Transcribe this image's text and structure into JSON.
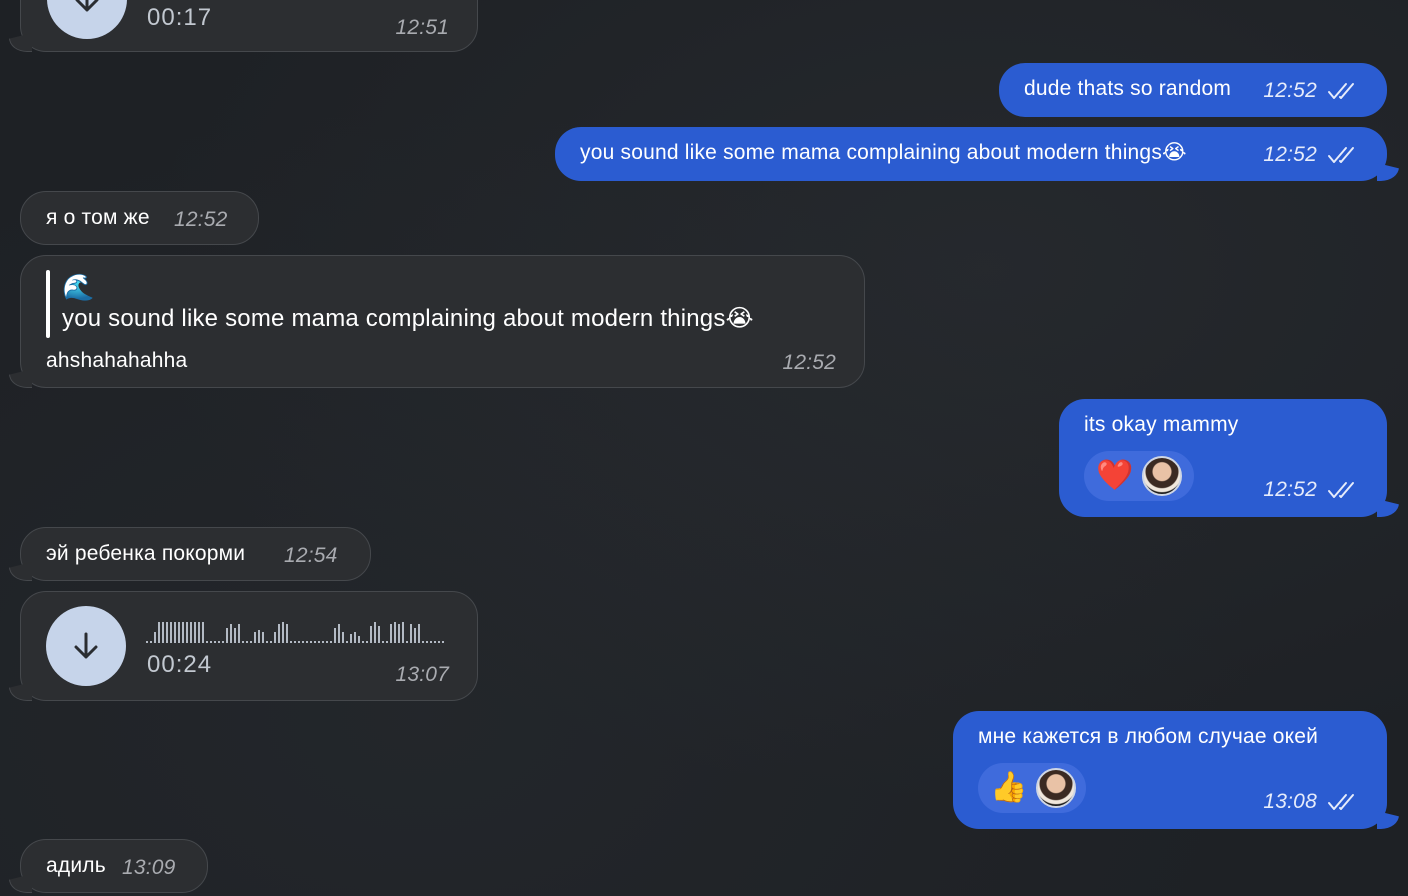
{
  "messages": {
    "voice_top": {
      "duration": "00:17",
      "time": "12:51"
    },
    "out_random": {
      "text": "dude thats so random",
      "time": "12:52"
    },
    "out_mama": {
      "text": "you sound like some mama complaining about modern things😭",
      "time": "12:52"
    },
    "in_same": {
      "text": "я о том же",
      "time": "12:52"
    },
    "in_reply": {
      "quote_emoji": "🌊",
      "quote_text": "you sound like some mama complaining about modern things😭",
      "text": "ahshahahahha",
      "time": "12:52"
    },
    "out_okay": {
      "text": "its okay mammy",
      "reaction": "❤️",
      "time": "12:52"
    },
    "in_feed": {
      "text": "эй ребенка покорми",
      "time": "12:54"
    },
    "voice_bottom": {
      "duration": "00:24",
      "time": "13:07"
    },
    "out_anyway": {
      "text": "мне кажется в любом случае окей",
      "reaction": "👍",
      "time": "13:08"
    },
    "in_adil": {
      "text": "адиль",
      "time": "13:09"
    }
  },
  "colors": {
    "background": "#1e2125",
    "incoming_bubble": "#2c2e31",
    "outgoing_bubble": "#2b5cd1",
    "voice_button": "#c6d4ea"
  },
  "icons": {
    "download": "arrow-down-icon",
    "read_status": "double-check-icon",
    "reaction_avatar": "avatar"
  }
}
